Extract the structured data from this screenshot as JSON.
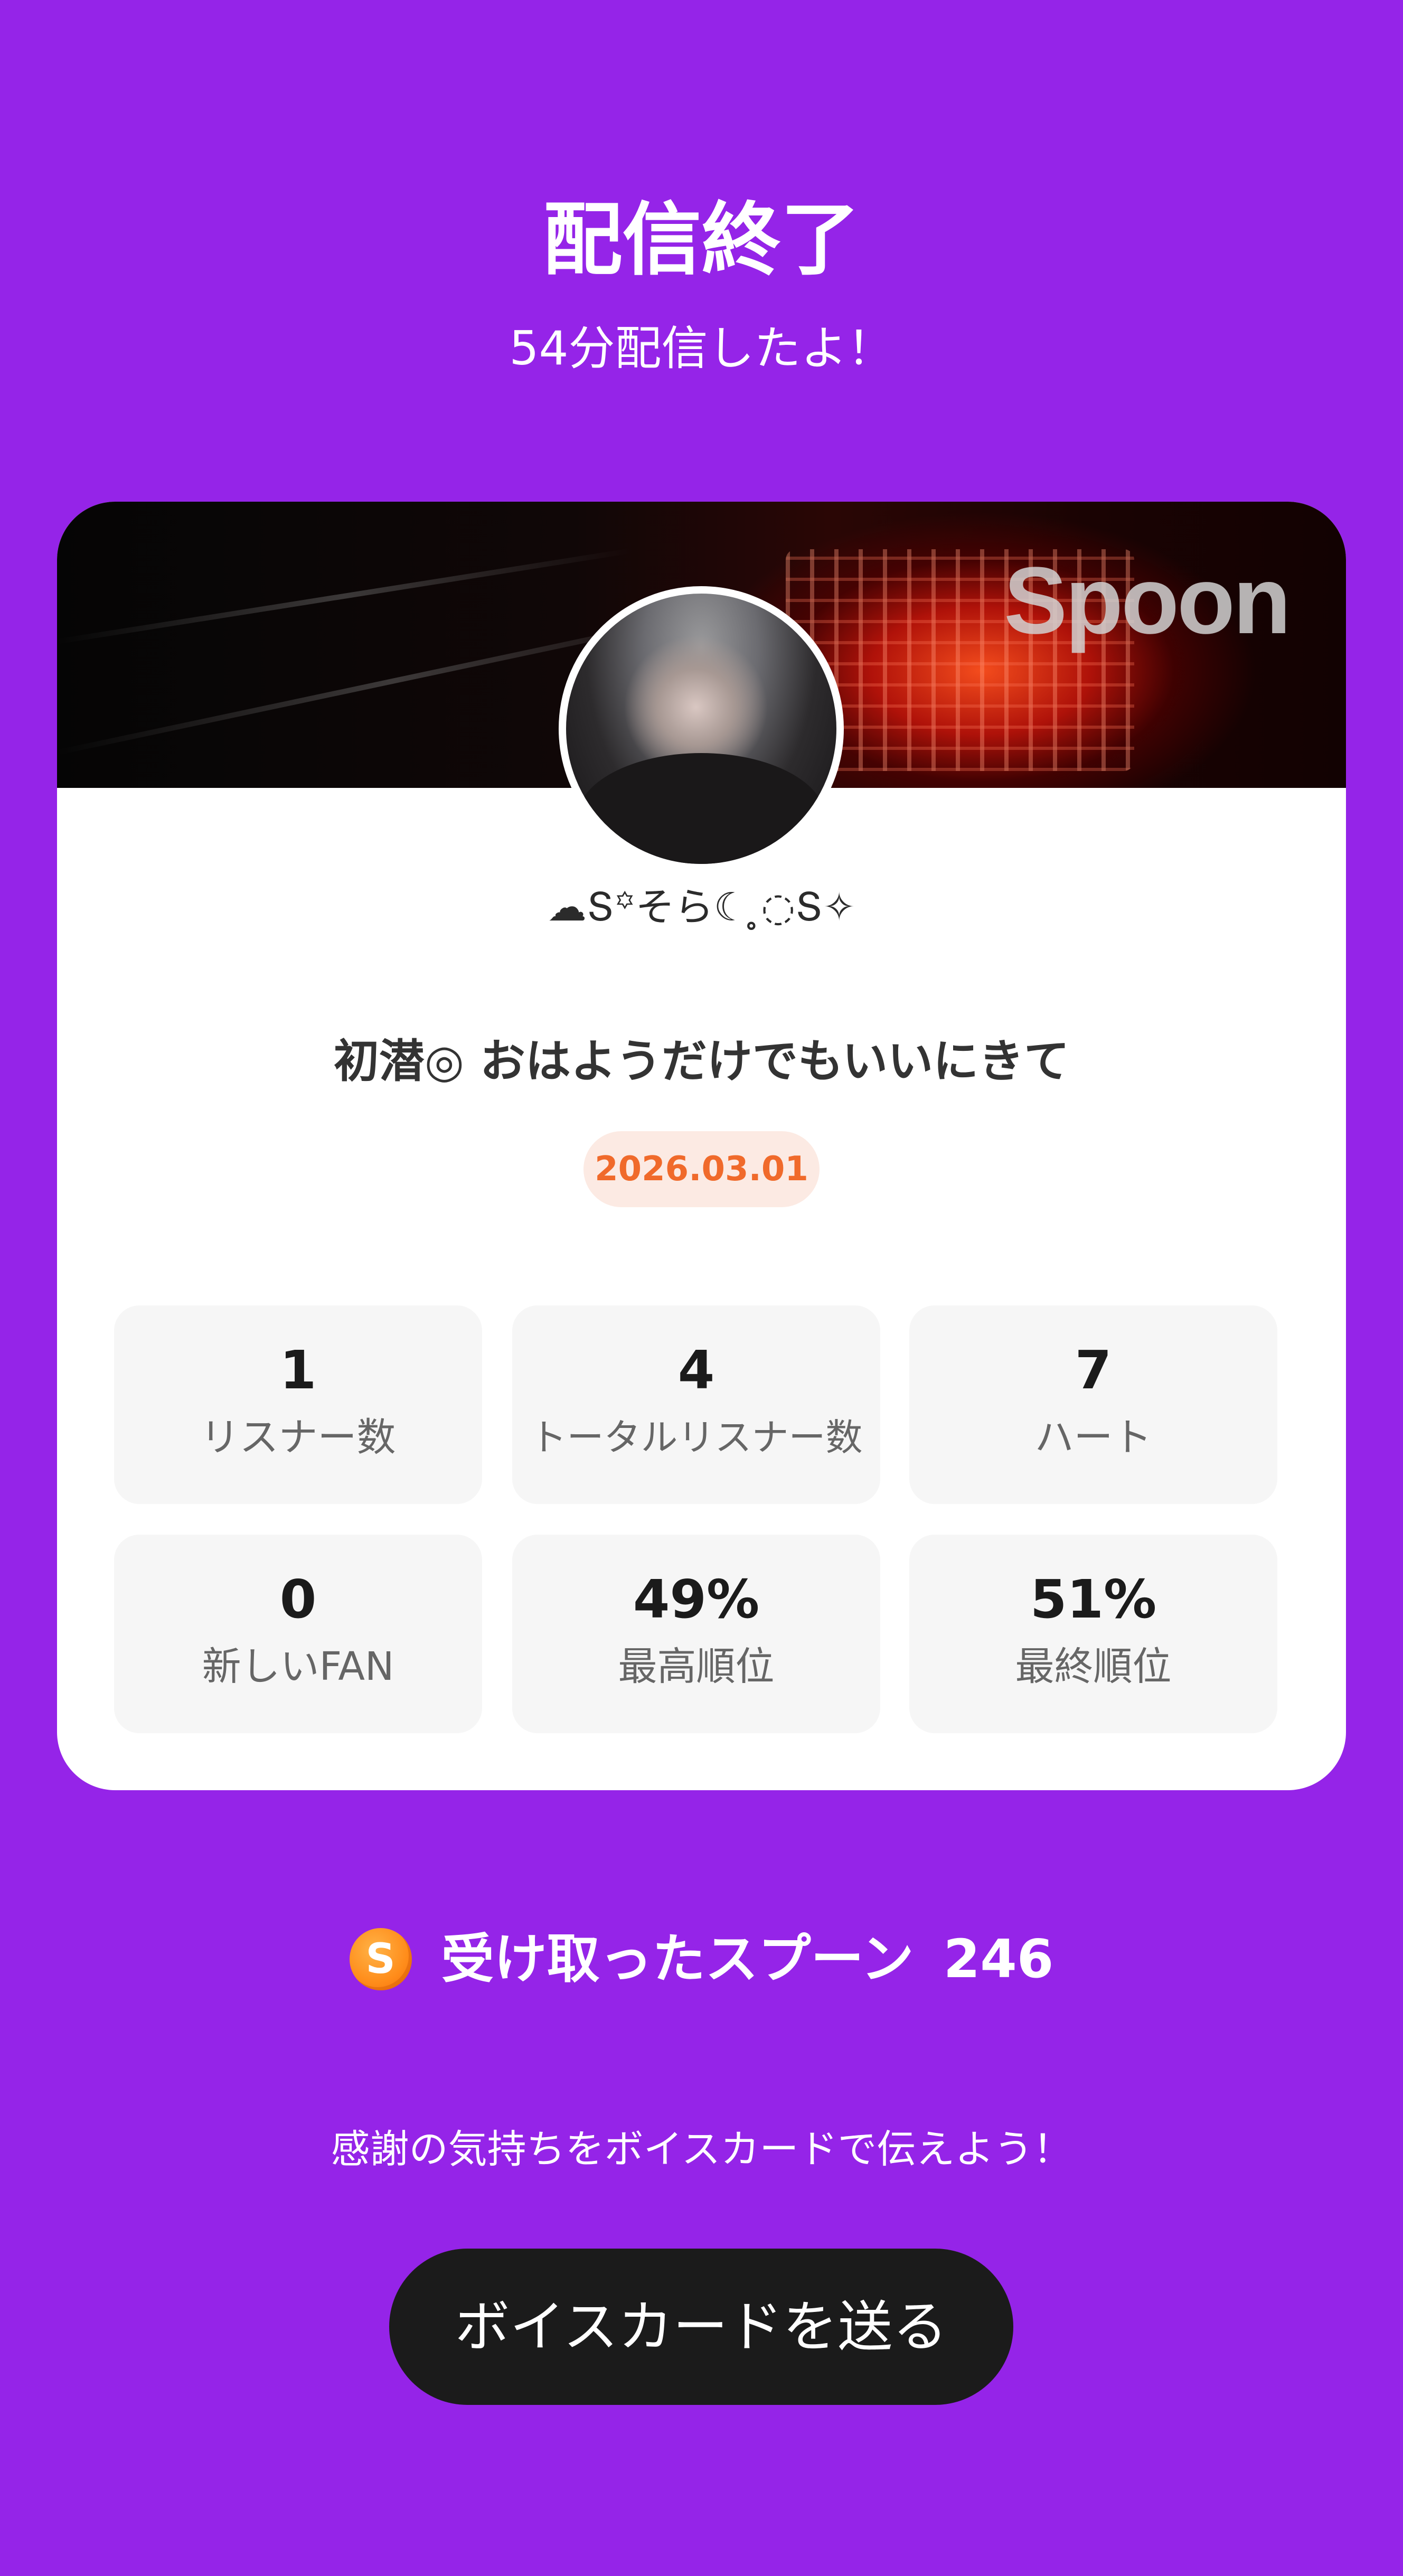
{
  "header": {
    "title": "配信終了",
    "subtitle": "54分配信したよ！"
  },
  "card": {
    "brand": "Spoon",
    "username": "☁︎Տ꙳そら☾ ̥◌Տ✧",
    "stream_title": "初潜◎ おはようだけでもいいにきて",
    "date": "2026.03.01",
    "stats": [
      {
        "value": "1",
        "label": "リスナー数"
      },
      {
        "value": "4",
        "label": "トータルリスナー数"
      },
      {
        "value": "7",
        "label": "ハート"
      },
      {
        "value": "0",
        "label": "新しいFAN"
      },
      {
        "value": "49%",
        "label": "最高順位"
      },
      {
        "value": "51%",
        "label": "最終順位"
      }
    ]
  },
  "spoons": {
    "icon_letter": "S",
    "label": "受け取ったスプーン",
    "count": "246"
  },
  "footer": {
    "message": "感謝の気持ちをボイスカードで伝えよう！",
    "button_label": "ボイスカードを送る"
  },
  "colors": {
    "background": "#9524E8",
    "card": "#FFFFFF",
    "date_badge_bg": "#FCEAE3",
    "date_badge_text": "#F06A2B",
    "button": "#1B1B1B",
    "coin": "#FF8C1A"
  },
  "icons": {
    "coin": "spoon-coin-icon"
  }
}
